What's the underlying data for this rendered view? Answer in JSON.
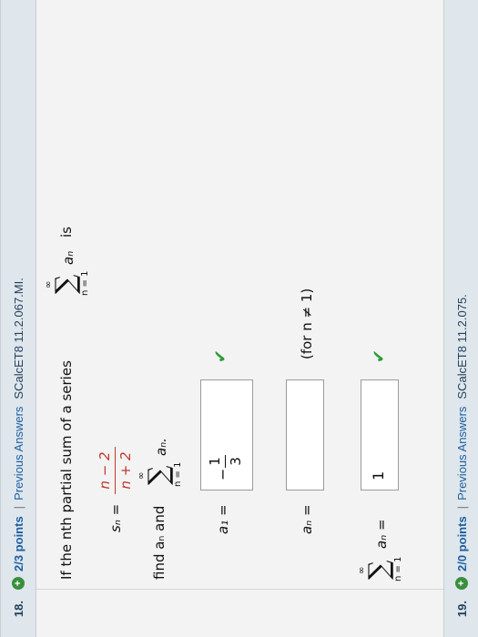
{
  "q18": {
    "number": "18.",
    "plus": "+",
    "points": "2/3 points",
    "separator": "|",
    "previous_answers": "Previous Answers",
    "code": "SCalcET8 11.2.067.MI.",
    "prompt_prefix": "If the nth partial sum of a series",
    "prompt_suffix": "is",
    "sigma": "∑",
    "upper_limit": "∞",
    "lower_limit": "n = 1",
    "term": "aₙ",
    "sn_lhs": "sₙ =",
    "sn_num": "n − 2",
    "sn_den": "n + 2",
    "find_text": "find aₙ and",
    "find_term": "aₙ.",
    "a1_label": "a₁ =",
    "a1_minus": "−",
    "a1_num": "1",
    "a1_den": "3",
    "an_label": "aₙ =",
    "an_value": "",
    "for_note": "(for n ≠ 1)",
    "sum_label": "aₙ =",
    "sum_value": "1",
    "a1_status": "correct",
    "sum_status": "correct"
  },
  "q19": {
    "number": "19.",
    "plus": "+",
    "points": "2/0 points",
    "separator": "|",
    "previous_answers": "Previous Answers",
    "code": "SCalcET8 11.2.075."
  },
  "colors": {
    "header_bg": "#dfe6ec",
    "link": "#1d5fa0",
    "check": "#2e9a3a",
    "fraction_red": "#c0392b"
  },
  "icons": [
    "plus-circle-icon",
    "check-icon"
  ]
}
